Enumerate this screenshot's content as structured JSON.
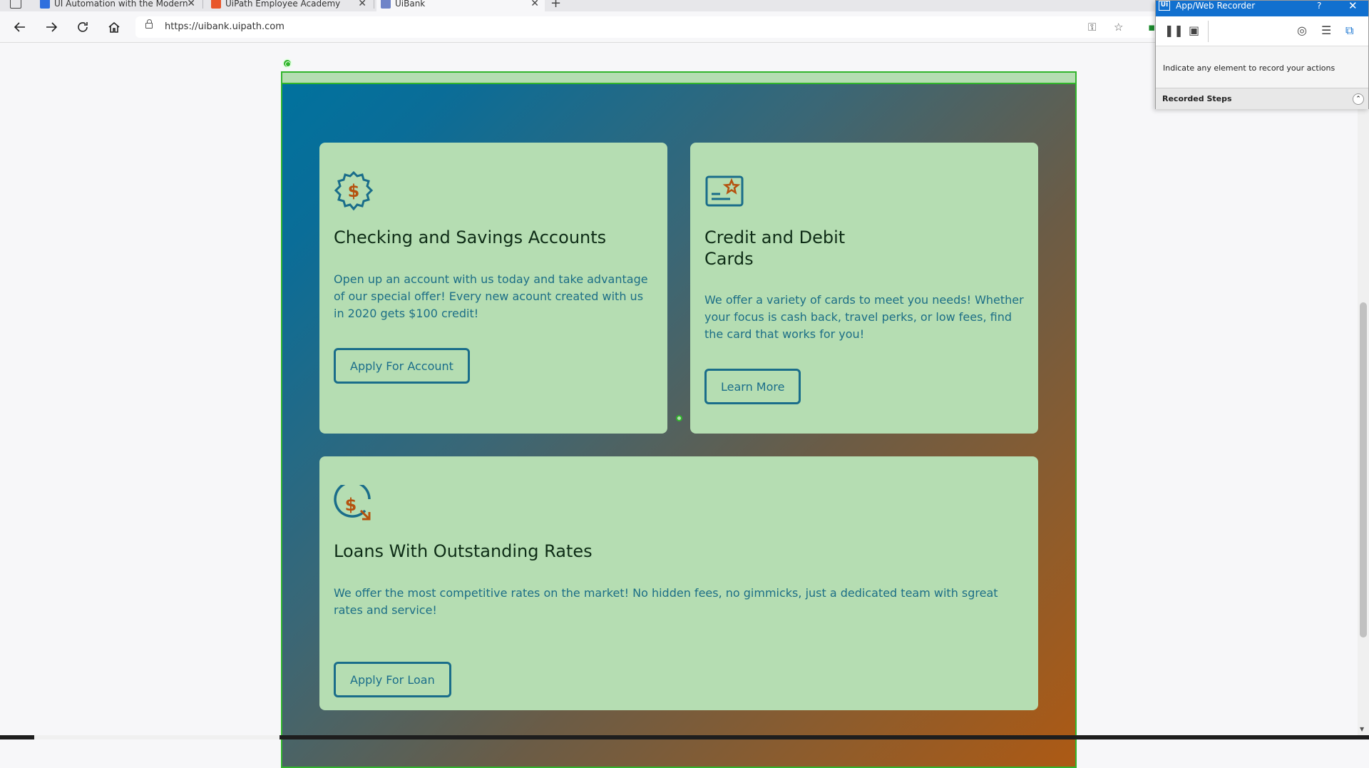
{
  "browser": {
    "tabs": [
      {
        "title": "UI Automation with the Modern",
        "favicon_color": "#2f6fde",
        "active": false
      },
      {
        "title": "UiPath Employee Academy",
        "favicon_color": "#e8562a",
        "active": false
      },
      {
        "title": "UiBank",
        "favicon_color": "#6f84c8",
        "active": true
      }
    ],
    "url": "https://uibank.uipath.com"
  },
  "cards": [
    {
      "icon": "dollar-badge-icon",
      "title": "Checking and Savings Accounts",
      "text": "Open up an account with us today and take advantage of our special offer! Every new acount created with us in 2020 gets $100 credit!",
      "button": "Apply For Account"
    },
    {
      "icon": "credit-card-star-icon",
      "title": "Credit and Debit Cards",
      "text": "We offer a variety of cards to meet you needs! Whether your focus is cash back, travel perks, or low fees, find the card that works for you!",
      "button": "Learn More"
    },
    {
      "icon": "loan-dollar-icon",
      "title": "Loans With Outstanding Rates",
      "text": "We offer the most competitive rates on the market! No hidden fees, no gimmicks, just a dedicated team with sgreat rates and service!",
      "button": "Apply For Loan"
    }
  ],
  "recorder": {
    "title": "App/Web Recorder",
    "help": "?",
    "message": "Indicate any element to record your actions",
    "steps_label": "Recorded Steps"
  },
  "colors": {
    "card_bg": "#b5ddb2",
    "accent_blue": "#1a6d8a",
    "accent_orange": "#b5520f",
    "selection_green": "#31b52c",
    "recorder_blue": "#1170cf"
  }
}
